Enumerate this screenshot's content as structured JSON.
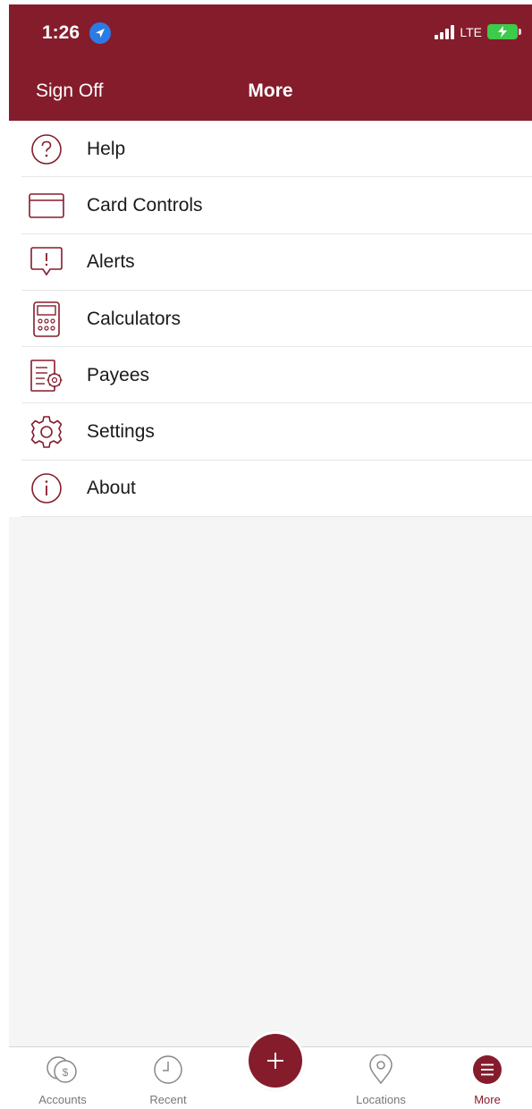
{
  "status_bar": {
    "time": "1:26",
    "network": "LTE"
  },
  "header": {
    "left_action": "Sign Off",
    "title": "More"
  },
  "menu": {
    "items": [
      {
        "label": "Help",
        "icon": "help-circle-icon"
      },
      {
        "label": "Card Controls",
        "icon": "card-icon"
      },
      {
        "label": "Alerts",
        "icon": "alert-bubble-icon"
      },
      {
        "label": "Calculators",
        "icon": "calculator-icon"
      },
      {
        "label": "Payees",
        "icon": "payees-document-icon"
      },
      {
        "label": "Settings",
        "icon": "gear-icon"
      },
      {
        "label": "About",
        "icon": "info-circle-icon"
      }
    ]
  },
  "tabbar": {
    "items": [
      {
        "label": "Accounts",
        "icon": "coins-icon"
      },
      {
        "label": "Recent",
        "icon": "clock-icon"
      },
      {
        "label": "",
        "icon": "plus-icon"
      },
      {
        "label": "Locations",
        "icon": "location-pin-icon"
      },
      {
        "label": "More",
        "icon": "menu-icon",
        "active": true
      }
    ]
  },
  "colors": {
    "brand": "#851c2c",
    "background": "#f5f5f5",
    "location_blue": "#2c7be5",
    "battery_green": "#3ccb4a"
  }
}
